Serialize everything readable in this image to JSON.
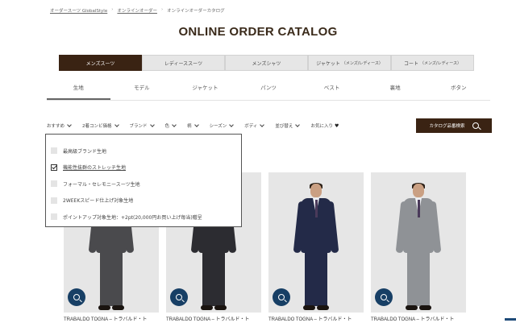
{
  "breadcrumb": [
    "オーダースーツ GlobalStyle",
    "オンラインオーダー",
    "オンラインオーダーカタログ"
  ],
  "page_title": "ONLINE ORDER CATALOG",
  "category_tabs": [
    {
      "label": "メンズスーツ",
      "sub": ""
    },
    {
      "label": "レディーススーツ",
      "sub": ""
    },
    {
      "label": "メンズシャツ",
      "sub": ""
    },
    {
      "label": "ジャケット",
      "sub": "（メンズ/レディース）"
    },
    {
      "label": "コート",
      "sub": "（メンズ/レディース）"
    }
  ],
  "sub_tabs": [
    "生地",
    "モデル",
    "ジャケット",
    "パンツ",
    "ベスト",
    "裏地",
    "ボタン"
  ],
  "filters": [
    "おすすめ",
    "2着コンビ価格",
    "ブランド",
    "色",
    "柄",
    "シーズン",
    "ボディ",
    "並び替え"
  ],
  "favorites_label": "お気に入り",
  "search_button": "カタログ品番検索",
  "dropdown_options": [
    {
      "label": "最高級ブランド生地",
      "checked": false
    },
    {
      "label": "機能性抜群のストレッチ生地",
      "checked": true
    },
    {
      "label": "フォーマル・セレモニースーツ生地",
      "checked": false
    },
    {
      "label": "2WEEKスピード仕上げ対象生地",
      "checked": false
    },
    {
      "label": "ポイントアップ対象生地：+2pt(20,000円お買い上げ毎当)贈呈",
      "checked": false
    }
  ],
  "products": [
    {
      "caption": "TRABALDO TOGNA – トラバルド・ト",
      "suit_color": "#4a4a4d",
      "pose": "partial"
    },
    {
      "caption": "TRABALDO TOGNA – トラバルド・ト",
      "suit_color": "#2c2c31",
      "pose": "partial"
    },
    {
      "caption": "TRABALDO TOGNA – トラバルド・ト",
      "suit_color": "#232a48",
      "pose": "full"
    },
    {
      "caption": "TRABALDO TOGNA – トラバルド・ト",
      "suit_color": "#8f9296",
      "pose": "full"
    }
  ],
  "colors": {
    "accent_dark": "#3a2313",
    "zoom_button": "#173f65"
  }
}
